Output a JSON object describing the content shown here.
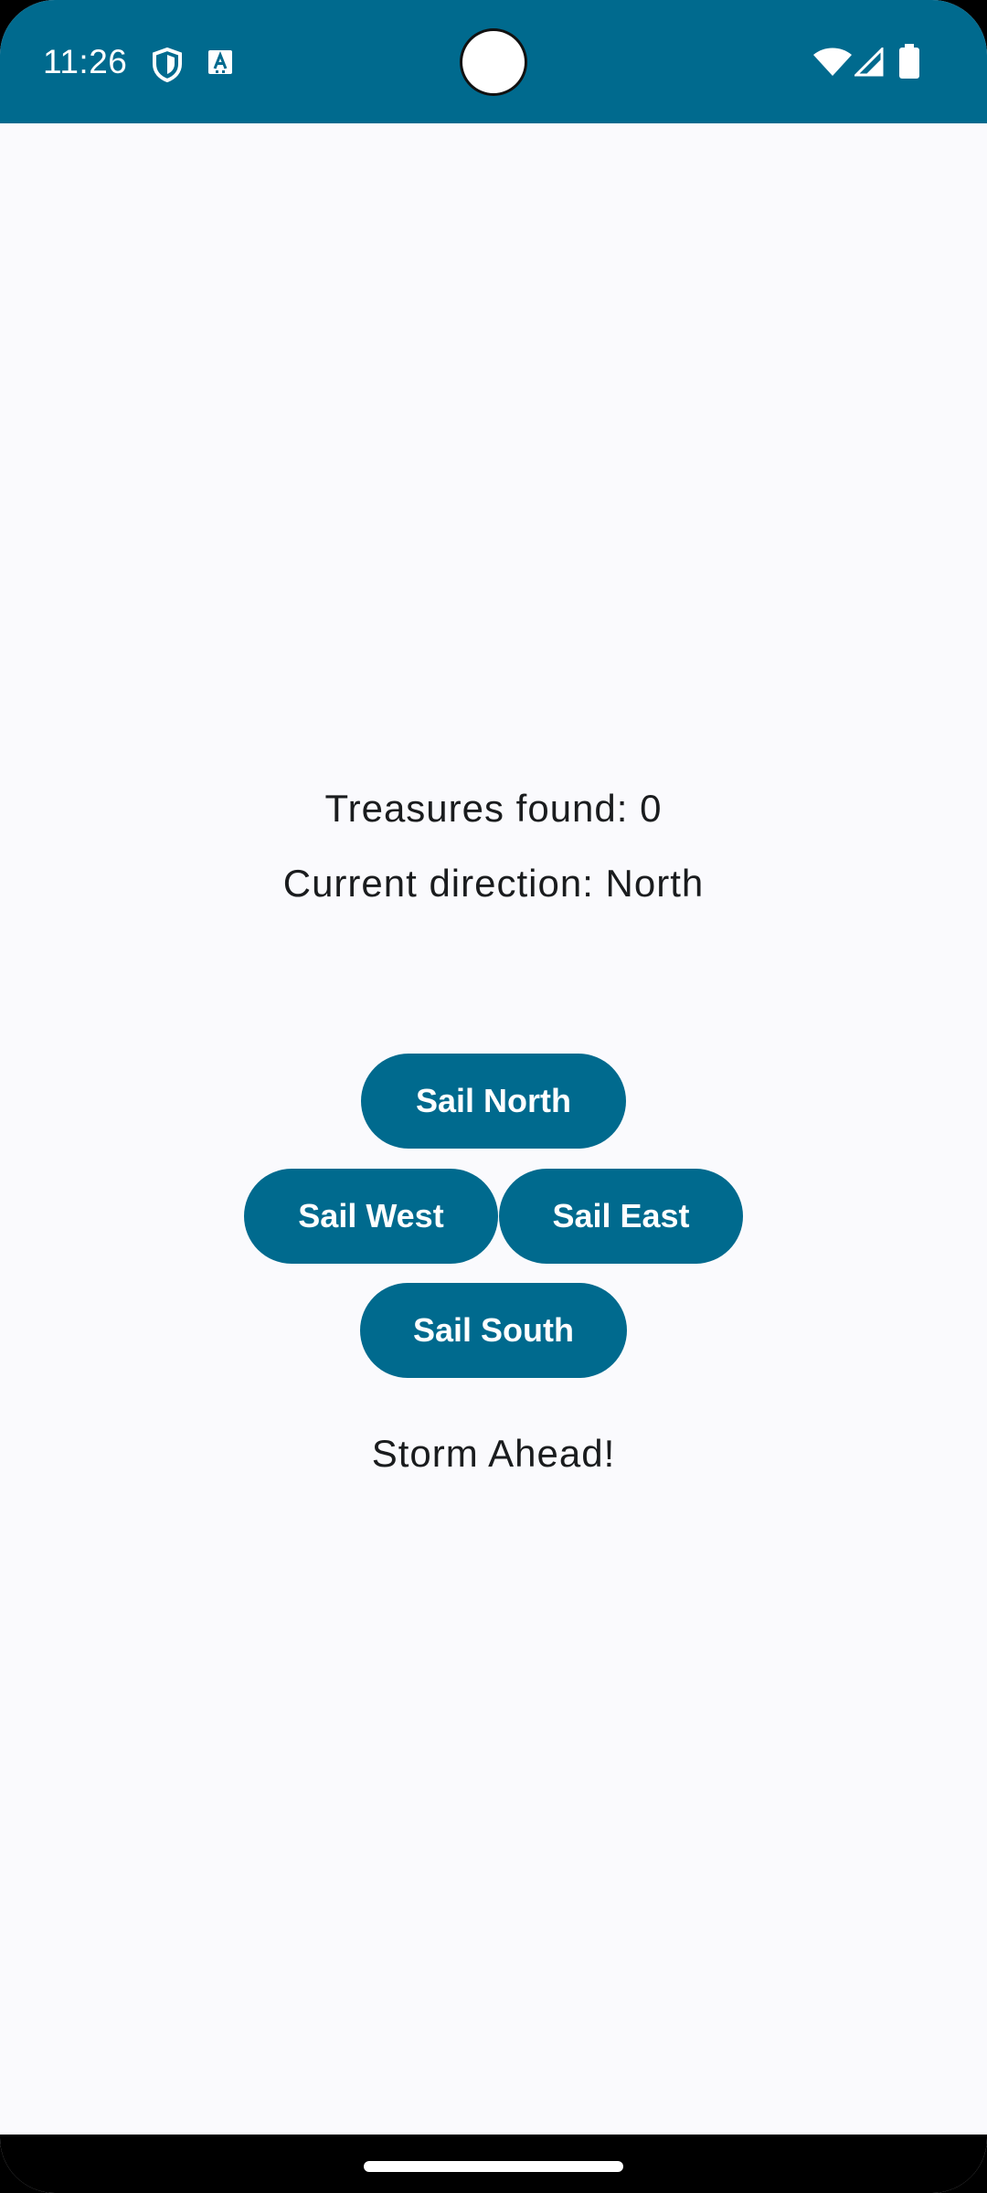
{
  "status_bar": {
    "time": "11:26",
    "icons": [
      "shield-icon",
      "translate-icon",
      "wifi-icon",
      "signal-icon",
      "battery-icon"
    ],
    "background_color": "#006A8E"
  },
  "game": {
    "treasures_label": "Treasures found: 0",
    "direction_label": "Current direction: North",
    "status_message": "Storm Ahead!"
  },
  "controls": {
    "north_label": "Sail North",
    "west_label": "Sail West",
    "east_label": "Sail East",
    "south_label": "Sail South",
    "button_color": "#006A8E"
  }
}
